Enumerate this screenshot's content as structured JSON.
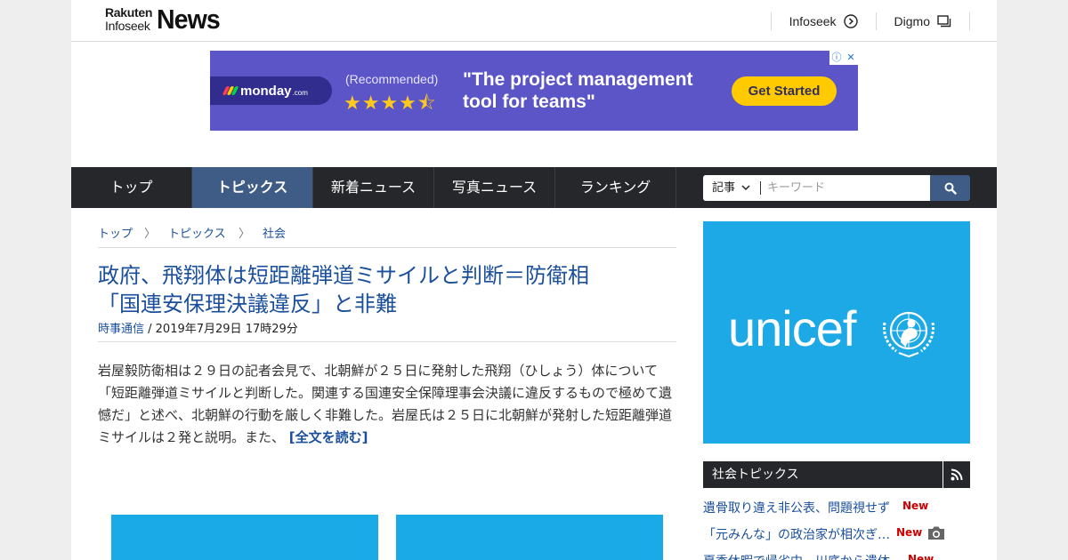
{
  "header": {
    "logo_small_1": "Rakuten",
    "logo_small_2": "Infoseek",
    "logo_main": "News",
    "links": [
      "Infoseek",
      "Digmo"
    ]
  },
  "ad": {
    "brand": "monday",
    "brand_suffix": ".com",
    "recommended": "(Recommended)",
    "stars": "★★★★⯪",
    "headline_1": "\"The project management",
    "headline_2": "tool for teams\"",
    "cta": "Get Started",
    "info": "ⓘ",
    "close": "✕"
  },
  "nav": {
    "items": [
      "トップ",
      "トピックス",
      "新着ニュース",
      "写真ニュース",
      "ランキング"
    ],
    "active_index": 1,
    "search_category": "記事",
    "search_placeholder": "キーワード"
  },
  "breadcrumb": [
    "トップ",
    "トピックス",
    "社会"
  ],
  "breadcrumb_sep": "〉",
  "article": {
    "title_line_1": "政府、飛翔体は短距離弾道ミサイルと判断＝防衛相",
    "title_line_2": "「国連安保理決議違反」と非難",
    "source": "時事通信",
    "date": " / 2019年7月29日 17時29分",
    "body": "岩屋毅防衛相は２９日の記者会見で、北朝鮮が２５日に発射した飛翔（ひしょう）体について「短距離弾道ミサイルと判断した。関連する国連安全保障理事会決議に違反するもので極めて遺憾だ」と述べ、北朝鮮の行動を厳しく非難した。岩屋氏は２５日に北朝鮮が発射した短距離弾道ミサイルは２発と説明。また、",
    "read_more": "[全文を読む]"
  },
  "side": {
    "banner_word": "unicef",
    "topics_title": "社会トピックス",
    "topics": [
      {
        "text": "遺骨取り違え非公表、問題視せず",
        "badge": "New",
        "camera": false
      },
      {
        "text": "「元みんな」の政治家が相次ぎ…",
        "badge": "New",
        "camera": true
      },
      {
        "text": "夏季休暇で帰省中　川底から遺体",
        "badge": "New",
        "camera": false
      }
    ]
  },
  "colors": {
    "nav_bg": "#26272b",
    "nav_active": "#3f5c86",
    "link": "#1a4f9c",
    "ad_bg": "#5b55c7",
    "unicef_bg": "#1ca9e6",
    "new_badge": "#cc0000"
  }
}
